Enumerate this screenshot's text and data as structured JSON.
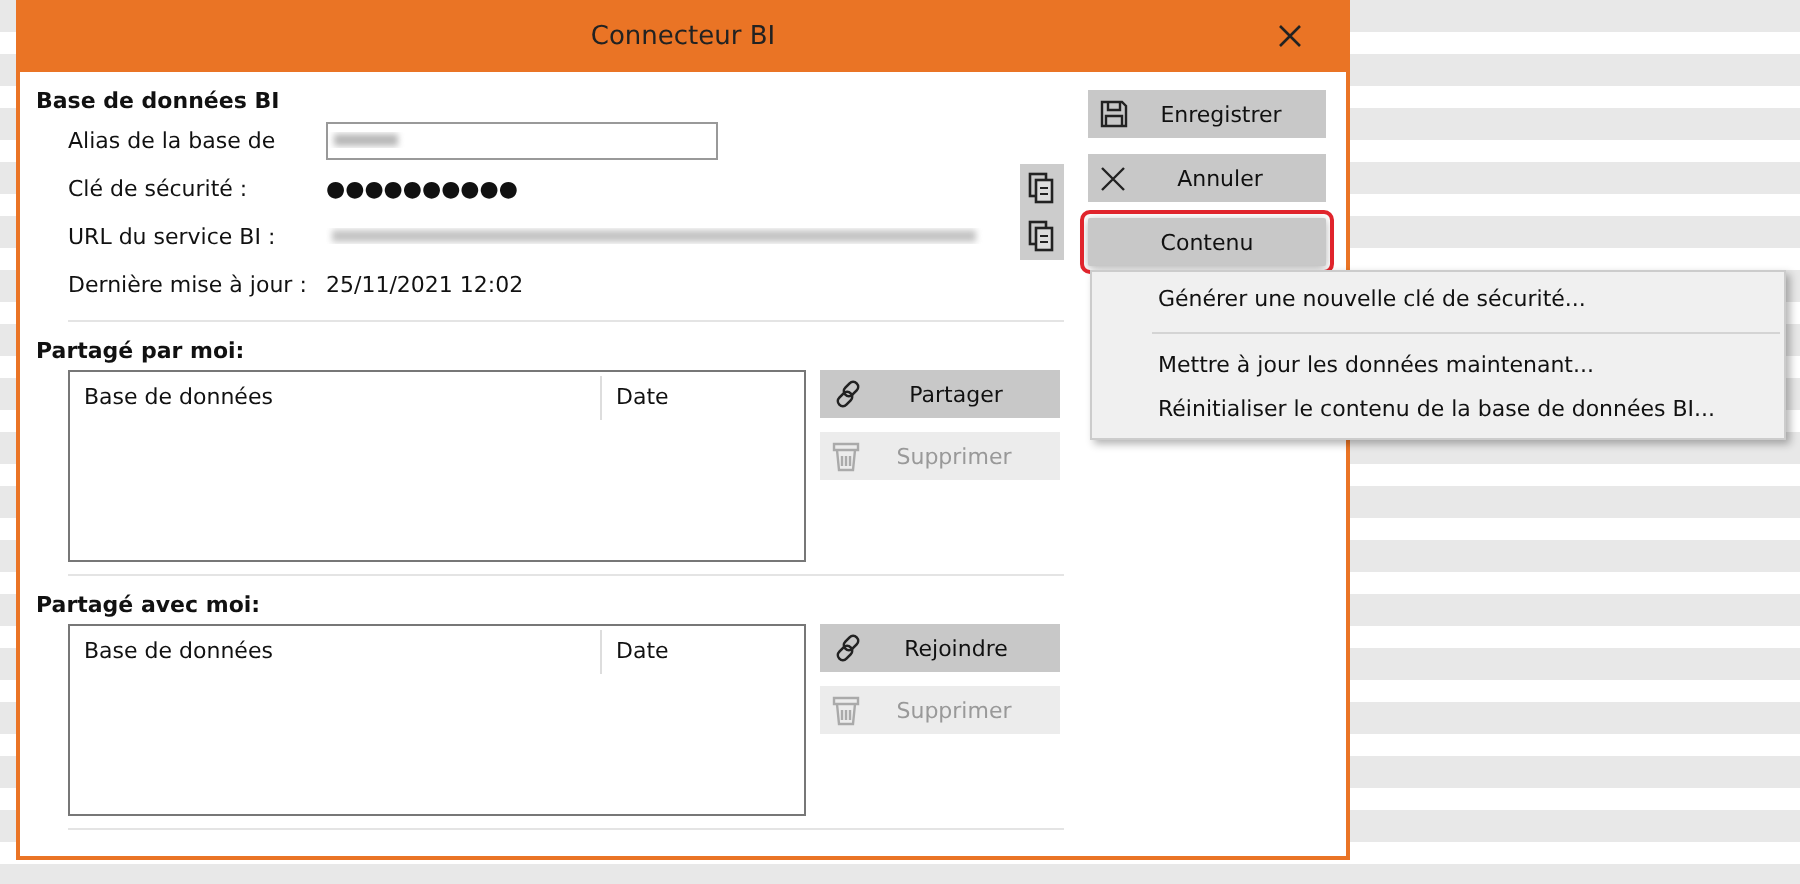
{
  "window": {
    "title": "Connecteur BI"
  },
  "database": {
    "heading": "Base de données BI",
    "fields": [
      {
        "label": "Alias de la base de",
        "kind": "input",
        "copyable": false
      },
      {
        "label": "Clé de sécurité :",
        "kind": "text",
        "value": "●●●●●●●●●●",
        "copyable": true
      },
      {
        "label": "URL du service BI :",
        "kind": "blurred",
        "copyable": true
      },
      {
        "label": "Dernière mise à jour :",
        "kind": "text",
        "value": "25/11/2021 12:02",
        "copyable": false
      }
    ]
  },
  "actions": [
    {
      "label": "Enregistrer",
      "kind": "save",
      "focused": false
    },
    {
      "label": "Annuler",
      "kind": "cancel",
      "focused": false
    },
    {
      "label": "Contenu",
      "kind": "plain",
      "focused": true
    }
  ],
  "menu": {
    "items": [
      {
        "kind": "item",
        "label": "Générer une nouvelle clé de sécurité..."
      },
      {
        "kind": "separator"
      },
      {
        "kind": "item",
        "label": "Mettre à jour les données maintenant..."
      },
      {
        "kind": "item",
        "label": "Réinitialiser le contenu de la base de données BI..."
      }
    ]
  },
  "sections": [
    {
      "heading": "Partagé par moi:",
      "columns": [
        "Base de données",
        "Date"
      ],
      "buttons": [
        {
          "label": "Partager",
          "kind": "link",
          "disabled": false
        },
        {
          "label": "Supprimer",
          "kind": "delete",
          "disabled": true
        }
      ]
    },
    {
      "heading": "Partagé avec moi:",
      "columns": [
        "Base de données",
        "Date"
      ],
      "buttons": [
        {
          "label": "Rejoindre",
          "kind": "link",
          "disabled": false
        },
        {
          "label": "Supprimer",
          "kind": "delete",
          "disabled": true
        }
      ]
    }
  ]
}
